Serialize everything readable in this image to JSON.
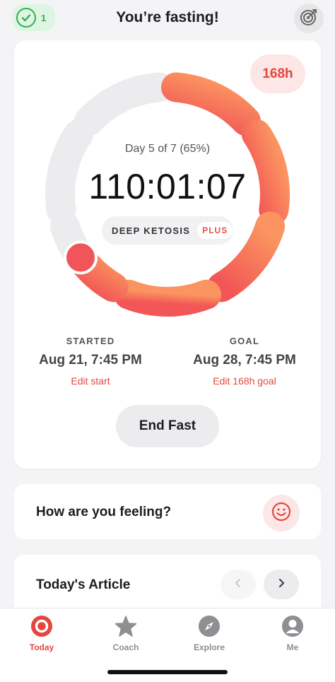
{
  "header": {
    "title": "You’re fasting!",
    "streak_count": "1",
    "streak_icon": "check-circle-icon",
    "goal_icon": "target-icon"
  },
  "timer": {
    "hours_badge": "168h",
    "day_progress": "Day 5 of 7 (65%)",
    "elapsed": "110:01:07",
    "progress_fraction": 0.65,
    "stage": "DEEP KETOSIS",
    "stage_badge": "PLUS",
    "started_label": "STARTED",
    "started_value": "Aug 21, 7:45 PM",
    "edit_start": "Edit start",
    "goal_label": "GOAL",
    "goal_value": "Aug 28, 7:45 PM",
    "edit_goal": "Edit 168h goal",
    "end_button": "End Fast"
  },
  "feeling": {
    "question": "How are you feeling?",
    "icon": "smiley-icon"
  },
  "article": {
    "heading": "Today's Article",
    "prev_icon": "chevron-left-icon",
    "next_icon": "chevron-right-icon"
  },
  "tabs": [
    {
      "label": "Today",
      "icon": "record-circle-icon",
      "active": true
    },
    {
      "label": "Coach",
      "icon": "star-icon",
      "active": false
    },
    {
      "label": "Explore",
      "icon": "compass-icon",
      "active": false
    },
    {
      "label": "Me",
      "icon": "profile-icon",
      "active": false
    }
  ],
  "colors": {
    "accent": "#e4473f",
    "ring_start": "#fb9460",
    "ring_end": "#f25656",
    "ring_track": "#ececee",
    "streak": "#2fb14c"
  }
}
